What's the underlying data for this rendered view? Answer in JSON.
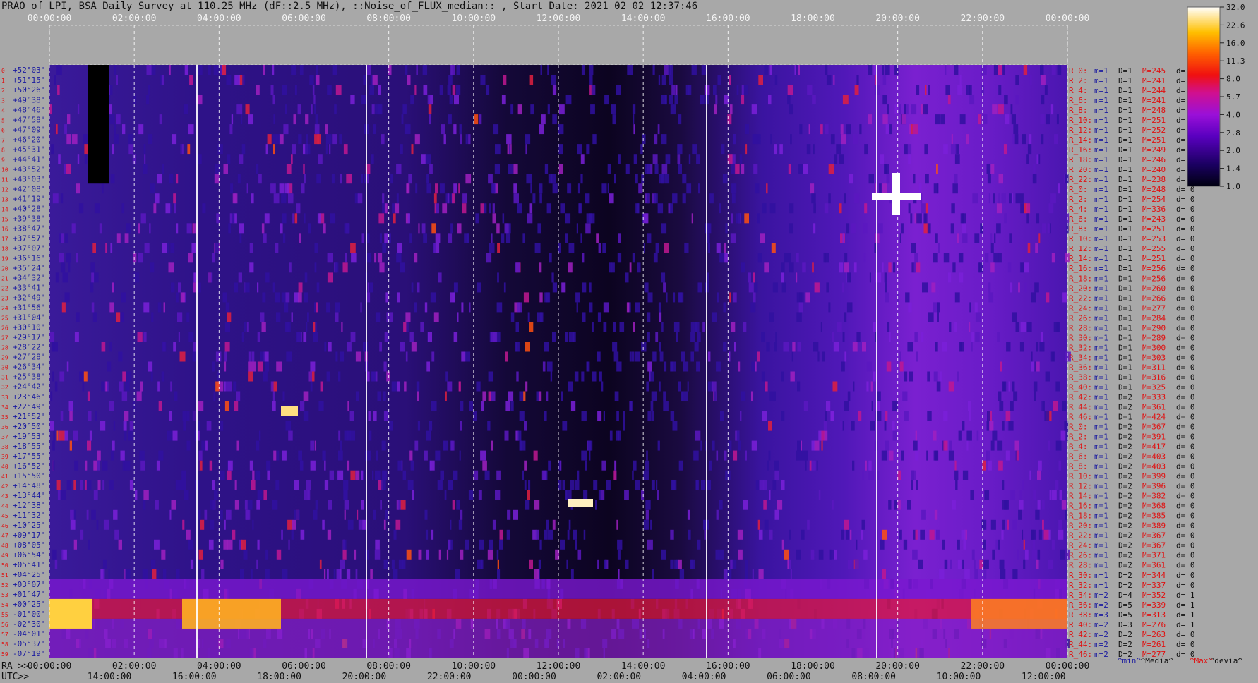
{
  "title": "PRAO of LPI, BSA Daily Survey at 110.25 MHz (dF::2.5 MHz), ::Noise_of_FLUX_median:: , Start Date: 2021 02 02 12:37:46",
  "colors": {
    "background": "#a8a8a8",
    "plot_bg": "#1a0a4a",
    "row_label_red": "#e01010",
    "row_label_blue": "#1a1aa0",
    "text_dark": "#101010",
    "grid_white": "#ffffff",
    "ra_line": "#e0e0e0"
  },
  "chart_data": {
    "type": "heatmap",
    "title": "PRAO of LPI, BSA Daily Survey at 110.25 MHz (dF::2.5 MHz), ::Noise_of_FLUX_median:: , Start Date: 2021 02 02 12:37:46",
    "top_axis_ticks": [
      "00:00:00",
      "02:00:00",
      "04:00:00",
      "06:00:00",
      "08:00:00",
      "10:00:00",
      "12:00:00",
      "14:00:00",
      "16:00:00",
      "18:00:00",
      "20:00:00",
      "22:00:00",
      "00:00:00"
    ],
    "bottom_ra_label": "RA >>",
    "bottom_ra_ticks": [
      "00:00:00",
      "02:00:00",
      "04:00:00",
      "06:00:00",
      "08:00:00",
      "10:00:00",
      "12:00:00",
      "14:00:00",
      "16:00:00",
      "18:00:00",
      "20:00:00",
      "22:00:00",
      "00:00:00"
    ],
    "bottom_utc_label": "UTC>>",
    "bottom_utc_ticks": [
      "14:00:00",
      "16:00:00",
      "18:00:00",
      "20:00:00",
      "22:00:00",
      "00:00:00",
      "02:00:00",
      "04:00:00",
      "06:00:00",
      "08:00:00",
      "10:00:00",
      "12:00:00"
    ],
    "colorbar": {
      "ticks": [
        "32.0",
        "22.6",
        "16.0",
        "11.3",
        "8.0",
        "5.7",
        "4.0",
        "2.8",
        "2.0",
        "1.4",
        "1.0"
      ],
      "range": [
        1.0,
        32.0
      ],
      "scale": "log"
    },
    "declinations": [
      "+52°03'",
      "+51°15'",
      "+50°26'",
      "+49°38'",
      "+48°46'",
      "+47°58'",
      "+47°09'",
      "+46°20'",
      "+45°31'",
      "+44°41'",
      "+43°52'",
      "+43°03'",
      "+42°08'",
      "+41°19'",
      "+40°28'",
      "+39°38'",
      "+38°47'",
      "+37°57'",
      "+37°07'",
      "+36°16'",
      "+35°24'",
      "+34°32'",
      "+33°41'",
      "+32°49'",
      "+31°56'",
      "+31°04'",
      "+30°10'",
      "+29°17'",
      "+28°22'",
      "+27°28'",
      "+26°34'",
      "+25°38'",
      "+24°42'",
      "+23°46'",
      "+22°49'",
      "+21°52'",
      "+20°50'",
      "+19°53'",
      "+18°55'",
      "+17°55'",
      "+16°52'",
      "+15°50'",
      "+14°48'",
      "+13°44'",
      "+12°38'",
      "+11°32'",
      "+10°25'",
      "+09°17'",
      "+08°05'",
      "+06°54'",
      "+05°41'",
      "+04°25'",
      "+03°07'",
      "+01°47'",
      "+00°25'",
      "-01°00'",
      "-02°30'",
      "-04°01'",
      "-05°37'",
      "-07°19'"
    ],
    "beam_labels": {
      "left_index": [
        "0",
        "1",
        "2",
        "3",
        "4",
        "5",
        "6",
        "7",
        "8",
        "9",
        "10",
        "11",
        "12",
        "13",
        "14",
        "15",
        "16",
        "17",
        "18",
        "19",
        "20",
        "21",
        "22",
        "23",
        "24",
        "25",
        "26",
        "27",
        "28",
        "29",
        "30",
        "31",
        "32",
        "33",
        "34",
        "35",
        "36",
        "37",
        "38",
        "39",
        "40",
        "41",
        "42",
        "43",
        "44",
        "45",
        "46",
        "47",
        "48",
        "49",
        "50",
        "51",
        "52",
        "53",
        "54",
        "55",
        "56",
        "57",
        "58",
        "59"
      ]
    },
    "rows": [
      {
        "r": "R_0:",
        "m": "m=1",
        "D": "D=1",
        "M": "M=245",
        "d": "d= 0"
      },
      {
        "r": "R_2:",
        "m": "m=1",
        "D": "D=1",
        "M": "M=241",
        "d": "d= 0"
      },
      {
        "r": "R_4:",
        "m": "m=1",
        "D": "D=1",
        "M": "M=244",
        "d": "d= 0"
      },
      {
        "r": "R_6:",
        "m": "m=1",
        "D": "D=1",
        "M": "M=241",
        "d": "d= 0"
      },
      {
        "r": "R_8:",
        "m": "m=1",
        "D": "D=1",
        "M": "M=248",
        "d": "d= 0"
      },
      {
        "r": "R_10:",
        "m": "m=1",
        "D": "D=1",
        "M": "M=251",
        "d": "d="
      },
      {
        "r": "R_12:",
        "m": "m=1",
        "D": "D=1",
        "M": "M=252",
        "d": "d="
      },
      {
        "r": "R_14:",
        "m": "m=1",
        "D": "D=1",
        "M": "M=251",
        "d": "d="
      },
      {
        "r": "R_16:",
        "m": "m=1",
        "D": "D=1",
        "M": "M=249",
        "d": "d="
      },
      {
        "r": "R_18:",
        "m": "m=1",
        "D": "D=1",
        "M": "M=246",
        "d": "d="
      },
      {
        "r": "R_20:",
        "m": "m=1",
        "D": "D=1",
        "M": "M=240",
        "d": "d="
      },
      {
        "r": "R_22:",
        "m": "m=1",
        "D": "D=1",
        "M": "M=238",
        "d": "d="
      },
      {
        "r": "R_0:",
        "m": "m=1",
        "D": "D=1",
        "M": "M=248",
        "d": "d= 0"
      },
      {
        "r": "R_2:",
        "m": "m=1",
        "D": "D=1",
        "M": "M=254",
        "d": "d= 0"
      },
      {
        "r": "R_4:",
        "m": "m=1",
        "D": "D=1",
        "M": "M=336",
        "d": "d= 0"
      },
      {
        "r": "R_6:",
        "m": "m=1",
        "D": "D=1",
        "M": "M=243",
        "d": "d= 0"
      },
      {
        "r": "R_8:",
        "m": "m=1",
        "D": "D=1",
        "M": "M=251",
        "d": "d= 0"
      },
      {
        "r": "R_10:",
        "m": "m=1",
        "D": "D=1",
        "M": "M=253",
        "d": "d= 0"
      },
      {
        "r": "R_12:",
        "m": "m=1",
        "D": "D=1",
        "M": "M=255",
        "d": "d= 0"
      },
      {
        "r": "R_14:",
        "m": "m=1",
        "D": "D=1",
        "M": "M=251",
        "d": "d= 0"
      },
      {
        "r": "R_16:",
        "m": "m=1",
        "D": "D=1",
        "M": "M=256",
        "d": "d= 0"
      },
      {
        "r": "R_18:",
        "m": "m=1",
        "D": "D=1",
        "M": "M=256",
        "d": "d= 0"
      },
      {
        "r": "R_20:",
        "m": "m=1",
        "D": "D=1",
        "M": "M=260",
        "d": "d= 0"
      },
      {
        "r": "R_22:",
        "m": "m=1",
        "D": "D=1",
        "M": "M=266",
        "d": "d= 0"
      },
      {
        "r": "R_24:",
        "m": "m=1",
        "D": "D=1",
        "M": "M=277",
        "d": "d= 0"
      },
      {
        "r": "R_26:",
        "m": "m=1",
        "D": "D=1",
        "M": "M=284",
        "d": "d= 0"
      },
      {
        "r": "R_28:",
        "m": "m=1",
        "D": "D=1",
        "M": "M=290",
        "d": "d= 0"
      },
      {
        "r": "R_30:",
        "m": "m=1",
        "D": "D=1",
        "M": "M=289",
        "d": "d= 0"
      },
      {
        "r": "R_32:",
        "m": "m=1",
        "D": "D=1",
        "M": "M=300",
        "d": "d= 0"
      },
      {
        "r": "R_34:",
        "m": "m=1",
        "D": "D=1",
        "M": "M=303",
        "d": "d= 0"
      },
      {
        "r": "R_36:",
        "m": "m=1",
        "D": "D=1",
        "M": "M=311",
        "d": "d= 0"
      },
      {
        "r": "R_38:",
        "m": "m=1",
        "D": "D=1",
        "M": "M=316",
        "d": "d= 0"
      },
      {
        "r": "R_40:",
        "m": "m=1",
        "D": "D=1",
        "M": "M=325",
        "d": "d= 0"
      },
      {
        "r": "R_42:",
        "m": "m=1",
        "D": "D=2",
        "M": "M=333",
        "d": "d= 0"
      },
      {
        "r": "R_44:",
        "m": "m=1",
        "D": "D=2",
        "M": "M=361",
        "d": "d= 0"
      },
      {
        "r": "R_46:",
        "m": "m=1",
        "D": "D=1",
        "M": "M=424",
        "d": "d= 0"
      },
      {
        "r": "R_0:",
        "m": "m=1",
        "D": "D=2",
        "M": "M=367",
        "d": "d= 0"
      },
      {
        "r": "R_2:",
        "m": "m=1",
        "D": "D=2",
        "M": "M=391",
        "d": "d= 0"
      },
      {
        "r": "R_4:",
        "m": "m=1",
        "D": "D=2",
        "M": "M=417",
        "d": "d= 0"
      },
      {
        "r": "R_6:",
        "m": "m=1",
        "D": "D=2",
        "M": "M=403",
        "d": "d= 0"
      },
      {
        "r": "R_8:",
        "m": "m=1",
        "D": "D=2",
        "M": "M=403",
        "d": "d= 0"
      },
      {
        "r": "R_10:",
        "m": "m=1",
        "D": "D=2",
        "M": "M=399",
        "d": "d= 0"
      },
      {
        "r": "R_12:",
        "m": "m=1",
        "D": "D=2",
        "M": "M=396",
        "d": "d= 0"
      },
      {
        "r": "R_14:",
        "m": "m=1",
        "D": "D=2",
        "M": "M=382",
        "d": "d= 0"
      },
      {
        "r": "R_16:",
        "m": "m=1",
        "D": "D=2",
        "M": "M=368",
        "d": "d= 0"
      },
      {
        "r": "R_18:",
        "m": "m=1",
        "D": "D=2",
        "M": "M=385",
        "d": "d= 0"
      },
      {
        "r": "R_20:",
        "m": "m=1",
        "D": "D=2",
        "M": "M=389",
        "d": "d= 0"
      },
      {
        "r": "R_22:",
        "m": "m=1",
        "D": "D=2",
        "M": "M=367",
        "d": "d= 0"
      },
      {
        "r": "R_24:",
        "m": "m=1",
        "D": "D=2",
        "M": "M=367",
        "d": "d= 0"
      },
      {
        "r": "R_26:",
        "m": "m=1",
        "D": "D=2",
        "M": "M=371",
        "d": "d= 0"
      },
      {
        "r": "R_28:",
        "m": "m=1",
        "D": "D=2",
        "M": "M=361",
        "d": "d= 0"
      },
      {
        "r": "R_30:",
        "m": "m=1",
        "D": "D=2",
        "M": "M=344",
        "d": "d= 0"
      },
      {
        "r": "R_32:",
        "m": "m=1",
        "D": "D=2",
        "M": "M=337",
        "d": "d= 0"
      },
      {
        "r": "R_34:",
        "m": "m=2",
        "D": "D=4",
        "M": "M=352",
        "d": "d= 1"
      },
      {
        "r": "R_36:",
        "m": "m=2",
        "D": "D=5",
        "M": "M=339",
        "d": "d= 1"
      },
      {
        "r": "R_38:",
        "m": "m=3",
        "D": "D=5",
        "M": "M=313",
        "d": "d= 1"
      },
      {
        "r": "R_40:",
        "m": "m=2",
        "D": "D=3",
        "M": "M=276",
        "d": "d= 1"
      },
      {
        "r": "R_42:",
        "m": "m=2",
        "D": "D=2",
        "M": "M=263",
        "d": "d= 0"
      },
      {
        "r": "R_44:",
        "m": "m=2",
        "D": "D=2",
        "M": "M=261",
        "d": "d= 0"
      },
      {
        "r": "R_46:",
        "m": "m=2",
        "D": "D=2",
        "M": "M=277",
        "d": "d= 0"
      }
    ],
    "legend_footer": [
      "^min^",
      "^Media^",
      "^Max^",
      "^devia^"
    ]
  }
}
